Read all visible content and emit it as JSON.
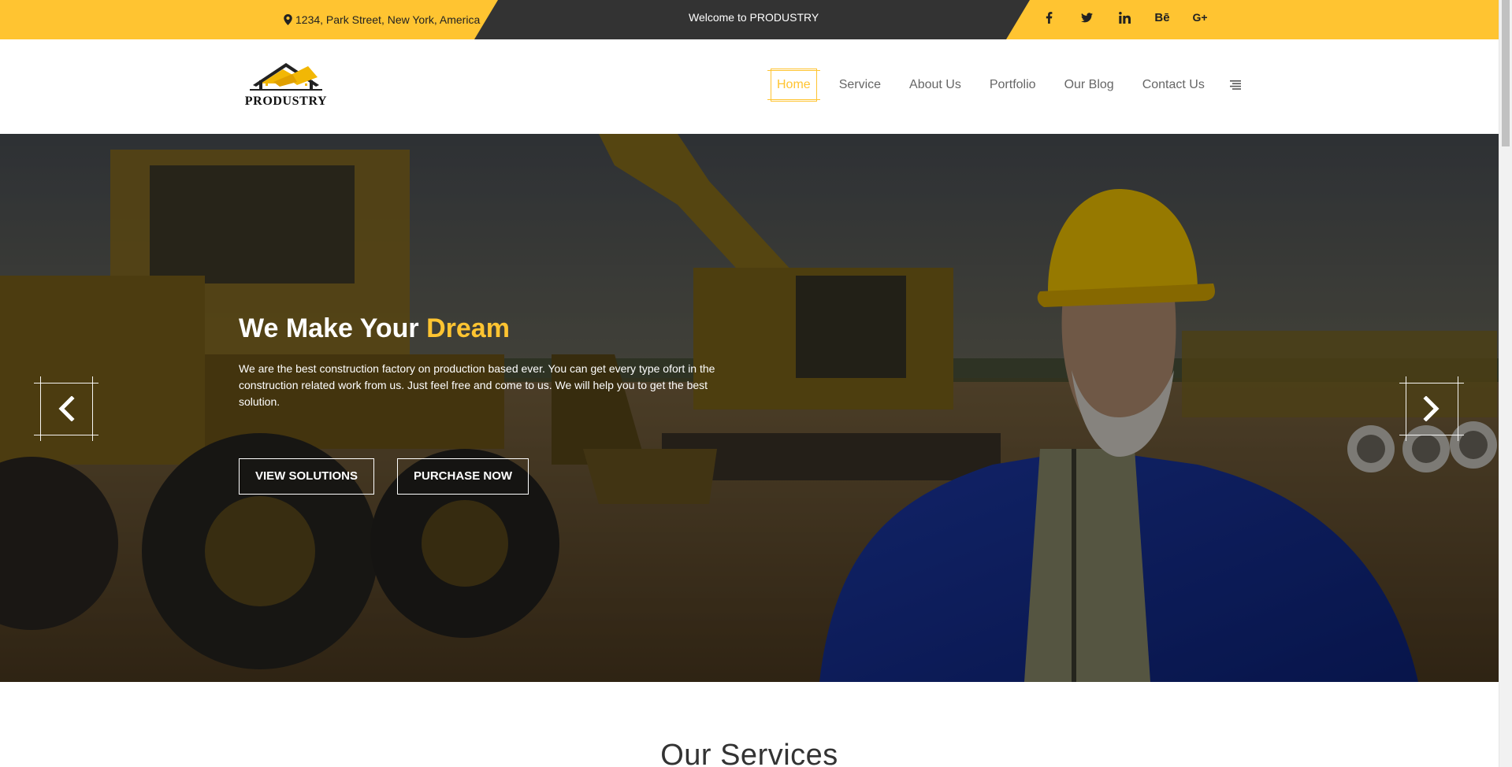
{
  "topbar": {
    "address": "1234, Park Street, New York, America",
    "welcome": "Welcome to PRODUSTRY",
    "social": [
      {
        "icon": "facebook-icon",
        "label": "f"
      },
      {
        "icon": "twitter-icon",
        "label": ""
      },
      {
        "icon": "linkedin-icon",
        "label": "in"
      },
      {
        "icon": "behance-icon",
        "label": "Bē"
      },
      {
        "icon": "google-plus-icon",
        "label": "G+"
      }
    ],
    "bg_color": "#ffc431",
    "dark_color": "#333333"
  },
  "header": {
    "logo_text": "PRODUSTRY",
    "nav": [
      {
        "label": "Home",
        "active": true
      },
      {
        "label": "Service"
      },
      {
        "label": "About Us"
      },
      {
        "label": "Portfolio"
      },
      {
        "label": "Our Blog"
      },
      {
        "label": "Contact Us"
      }
    ],
    "menu_icon": "menu-icon"
  },
  "hero": {
    "title_prefix": "We Make Your",
    "title_highlight": "Dream",
    "text": "We are the best construction factory on production based ever. You can get every type ofort in the construction related work from us. Just feel free and come to us. We will help you to get the best solution.",
    "buttons": {
      "view": "VIEW SOLUTIONS",
      "purchase": "PURCHASE NOW"
    },
    "prev_icon": "chevron-left-icon",
    "next_icon": "chevron-right-icon",
    "accent_color": "#ffc431"
  },
  "services": {
    "title": "Our Services"
  }
}
